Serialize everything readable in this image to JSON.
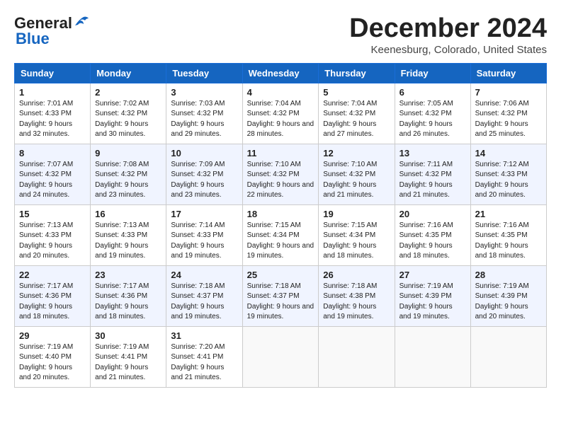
{
  "header": {
    "logo_general": "General",
    "logo_blue": "Blue",
    "month_title": "December 2024",
    "location": "Keenesburg, Colorado, United States"
  },
  "calendar": {
    "days_of_week": [
      "Sunday",
      "Monday",
      "Tuesday",
      "Wednesday",
      "Thursday",
      "Friday",
      "Saturday"
    ],
    "weeks": [
      [
        {
          "day": "1",
          "sunrise": "Sunrise: 7:01 AM",
          "sunset": "Sunset: 4:33 PM",
          "daylight": "Daylight: 9 hours and 32 minutes."
        },
        {
          "day": "2",
          "sunrise": "Sunrise: 7:02 AM",
          "sunset": "Sunset: 4:32 PM",
          "daylight": "Daylight: 9 hours and 30 minutes."
        },
        {
          "day": "3",
          "sunrise": "Sunrise: 7:03 AM",
          "sunset": "Sunset: 4:32 PM",
          "daylight": "Daylight: 9 hours and 29 minutes."
        },
        {
          "day": "4",
          "sunrise": "Sunrise: 7:04 AM",
          "sunset": "Sunset: 4:32 PM",
          "daylight": "Daylight: 9 hours and 28 minutes."
        },
        {
          "day": "5",
          "sunrise": "Sunrise: 7:04 AM",
          "sunset": "Sunset: 4:32 PM",
          "daylight": "Daylight: 9 hours and 27 minutes."
        },
        {
          "day": "6",
          "sunrise": "Sunrise: 7:05 AM",
          "sunset": "Sunset: 4:32 PM",
          "daylight": "Daylight: 9 hours and 26 minutes."
        },
        {
          "day": "7",
          "sunrise": "Sunrise: 7:06 AM",
          "sunset": "Sunset: 4:32 PM",
          "daylight": "Daylight: 9 hours and 25 minutes."
        }
      ],
      [
        {
          "day": "8",
          "sunrise": "Sunrise: 7:07 AM",
          "sunset": "Sunset: 4:32 PM",
          "daylight": "Daylight: 9 hours and 24 minutes."
        },
        {
          "day": "9",
          "sunrise": "Sunrise: 7:08 AM",
          "sunset": "Sunset: 4:32 PM",
          "daylight": "Daylight: 9 hours and 23 minutes."
        },
        {
          "day": "10",
          "sunrise": "Sunrise: 7:09 AM",
          "sunset": "Sunset: 4:32 PM",
          "daylight": "Daylight: 9 hours and 23 minutes."
        },
        {
          "day": "11",
          "sunrise": "Sunrise: 7:10 AM",
          "sunset": "Sunset: 4:32 PM",
          "daylight": "Daylight: 9 hours and 22 minutes."
        },
        {
          "day": "12",
          "sunrise": "Sunrise: 7:10 AM",
          "sunset": "Sunset: 4:32 PM",
          "daylight": "Daylight: 9 hours and 21 minutes."
        },
        {
          "day": "13",
          "sunrise": "Sunrise: 7:11 AM",
          "sunset": "Sunset: 4:32 PM",
          "daylight": "Daylight: 9 hours and 21 minutes."
        },
        {
          "day": "14",
          "sunrise": "Sunrise: 7:12 AM",
          "sunset": "Sunset: 4:33 PM",
          "daylight": "Daylight: 9 hours and 20 minutes."
        }
      ],
      [
        {
          "day": "15",
          "sunrise": "Sunrise: 7:13 AM",
          "sunset": "Sunset: 4:33 PM",
          "daylight": "Daylight: 9 hours and 20 minutes."
        },
        {
          "day": "16",
          "sunrise": "Sunrise: 7:13 AM",
          "sunset": "Sunset: 4:33 PM",
          "daylight": "Daylight: 9 hours and 19 minutes."
        },
        {
          "day": "17",
          "sunrise": "Sunrise: 7:14 AM",
          "sunset": "Sunset: 4:33 PM",
          "daylight": "Daylight: 9 hours and 19 minutes."
        },
        {
          "day": "18",
          "sunrise": "Sunrise: 7:15 AM",
          "sunset": "Sunset: 4:34 PM",
          "daylight": "Daylight: 9 hours and 19 minutes."
        },
        {
          "day": "19",
          "sunrise": "Sunrise: 7:15 AM",
          "sunset": "Sunset: 4:34 PM",
          "daylight": "Daylight: 9 hours and 18 minutes."
        },
        {
          "day": "20",
          "sunrise": "Sunrise: 7:16 AM",
          "sunset": "Sunset: 4:35 PM",
          "daylight": "Daylight: 9 hours and 18 minutes."
        },
        {
          "day": "21",
          "sunrise": "Sunrise: 7:16 AM",
          "sunset": "Sunset: 4:35 PM",
          "daylight": "Daylight: 9 hours and 18 minutes."
        }
      ],
      [
        {
          "day": "22",
          "sunrise": "Sunrise: 7:17 AM",
          "sunset": "Sunset: 4:36 PM",
          "daylight": "Daylight: 9 hours and 18 minutes."
        },
        {
          "day": "23",
          "sunrise": "Sunrise: 7:17 AM",
          "sunset": "Sunset: 4:36 PM",
          "daylight": "Daylight: 9 hours and 18 minutes."
        },
        {
          "day": "24",
          "sunrise": "Sunrise: 7:18 AM",
          "sunset": "Sunset: 4:37 PM",
          "daylight": "Daylight: 9 hours and 19 minutes."
        },
        {
          "day": "25",
          "sunrise": "Sunrise: 7:18 AM",
          "sunset": "Sunset: 4:37 PM",
          "daylight": "Daylight: 9 hours and 19 minutes."
        },
        {
          "day": "26",
          "sunrise": "Sunrise: 7:18 AM",
          "sunset": "Sunset: 4:38 PM",
          "daylight": "Daylight: 9 hours and 19 minutes."
        },
        {
          "day": "27",
          "sunrise": "Sunrise: 7:19 AM",
          "sunset": "Sunset: 4:39 PM",
          "daylight": "Daylight: 9 hours and 19 minutes."
        },
        {
          "day": "28",
          "sunrise": "Sunrise: 7:19 AM",
          "sunset": "Sunset: 4:39 PM",
          "daylight": "Daylight: 9 hours and 20 minutes."
        }
      ],
      [
        {
          "day": "29",
          "sunrise": "Sunrise: 7:19 AM",
          "sunset": "Sunset: 4:40 PM",
          "daylight": "Daylight: 9 hours and 20 minutes."
        },
        {
          "day": "30",
          "sunrise": "Sunrise: 7:19 AM",
          "sunset": "Sunset: 4:41 PM",
          "daylight": "Daylight: 9 hours and 21 minutes."
        },
        {
          "day": "31",
          "sunrise": "Sunrise: 7:20 AM",
          "sunset": "Sunset: 4:41 PM",
          "daylight": "Daylight: 9 hours and 21 minutes."
        },
        null,
        null,
        null,
        null
      ]
    ]
  }
}
